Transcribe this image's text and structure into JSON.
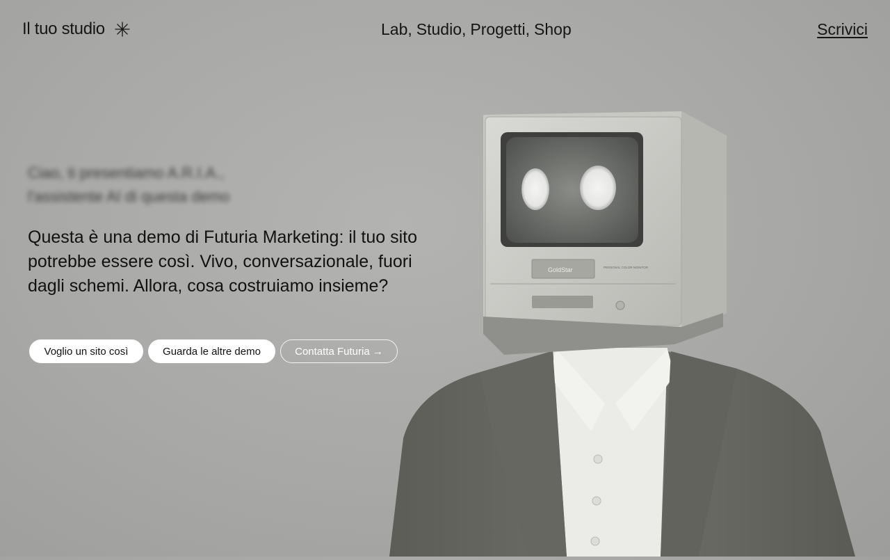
{
  "header": {
    "brand": "Il tuo studio",
    "nav_items": [
      "Lab",
      "Studio",
      "Progetti",
      "Shop"
    ],
    "nav_separator": ",",
    "cta": "Scrivici"
  },
  "hero": {
    "intro_line1": "Ciao, ti presentiamo A.R.I.A.,",
    "intro_line2": "l'assistente AI di questa demo",
    "headline": "Questa è una demo di Futuria Marketing: il tuo sito potrebbe essere così. Vivo, conversazionale, fuori dagli schemi. Allora, cosa costruiamo insieme?",
    "buttons": [
      {
        "label": "Voglio un sito così"
      },
      {
        "label": "Guarda le altre demo"
      },
      {
        "label": "Contatta Futuria →"
      }
    ]
  },
  "image": {
    "monitor_brand": "GoldStar",
    "monitor_model": "PERSONAL COLOR MONITOR"
  },
  "colors": {
    "background": "#a9a9a7",
    "text": "#111111",
    "button_bg": "#ffffff"
  }
}
